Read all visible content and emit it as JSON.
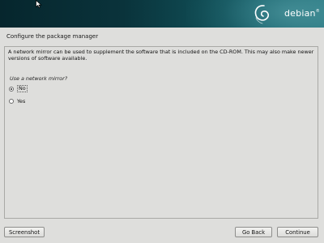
{
  "header": {
    "logo_text": "debian",
    "logo_mark": "®",
    "colors": {
      "banner_dark": "#06262d",
      "banner_light": "#2e7d86"
    }
  },
  "page": {
    "title": "Configure the package manager"
  },
  "panel": {
    "description": "A network mirror can be used to supplement the software that is included on the CD-ROM. This may also make newer versions of software available.",
    "question": "Use a network mirror?",
    "options": [
      {
        "label": "No",
        "selected": true,
        "focused": true
      },
      {
        "label": "Yes",
        "selected": false,
        "focused": false
      }
    ]
  },
  "buttons": {
    "screenshot": "Screenshot",
    "go_back": "Go Back",
    "continue": "Continue"
  },
  "icons": {
    "logo": "debian-swirl-icon",
    "cursor": "mouse-pointer-icon",
    "radio_selected": "radio-selected-icon",
    "radio_unselected": "radio-unselected-icon"
  }
}
